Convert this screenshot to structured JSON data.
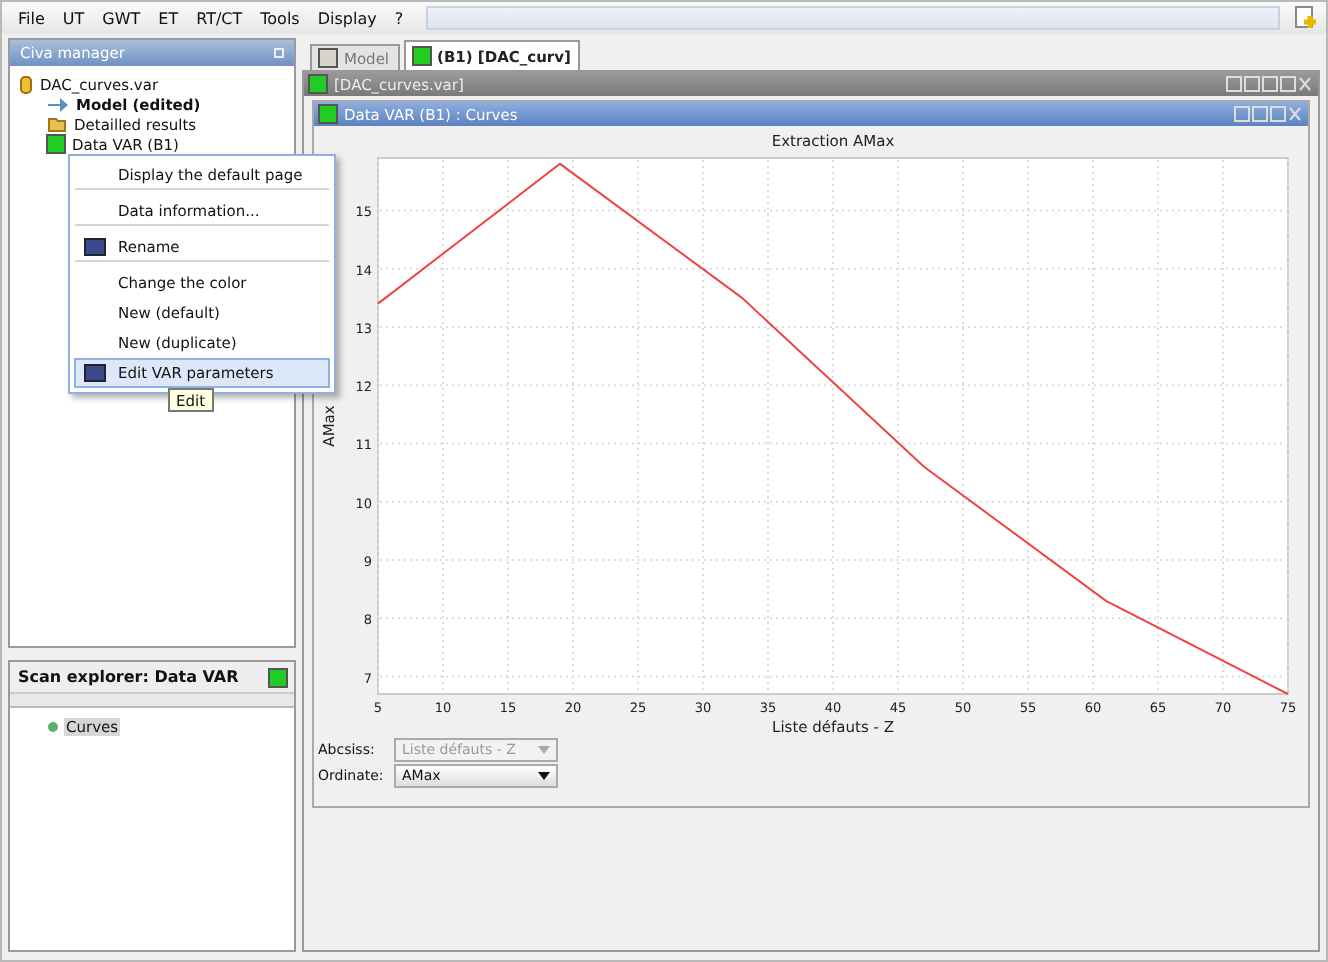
{
  "menu": [
    "File",
    "UT",
    "GWT",
    "ET",
    "RT/CT",
    "Tools",
    "Display",
    "?"
  ],
  "manager": {
    "title": "Civa manager",
    "tree": [
      {
        "label": "DAC_curves.var",
        "kind": "file",
        "bold": false,
        "children": [
          {
            "label": "Model (edited)",
            "kind": "model",
            "bold": true
          },
          {
            "label": "Detailled results",
            "kind": "folder",
            "bold": false
          },
          {
            "label": "Data VAR (B1)",
            "kind": "data",
            "bold": false
          }
        ]
      }
    ]
  },
  "context_menu": {
    "items": [
      {
        "label": "Display the default page",
        "icon": false,
        "selected": false,
        "separator_after": true
      },
      {
        "label": "Data information...",
        "icon": false,
        "selected": false,
        "separator_after": true
      },
      {
        "label": "Rename",
        "icon": true,
        "selected": false,
        "separator_after": true
      },
      {
        "label": "Change the color",
        "icon": false,
        "selected": false,
        "separator_after": false
      },
      {
        "label": "New (default)",
        "icon": false,
        "selected": false,
        "separator_after": false
      },
      {
        "label": "New (duplicate)",
        "icon": false,
        "selected": false,
        "separator_after": false
      },
      {
        "label": "Edit VAR parameters",
        "icon": true,
        "selected": true,
        "separator_after": false
      }
    ]
  },
  "tooltip": "Edit",
  "scan_explorer": {
    "title": "Scan explorer: Data VAR",
    "items": [
      {
        "label": "Curves",
        "selected": true
      }
    ]
  },
  "tabs": [
    {
      "label": "Model",
      "selected": false,
      "color": "#d8d4c8"
    },
    {
      "label": "(B1) [DAC_curv]",
      "selected": true,
      "color": "#22cc22"
    }
  ],
  "document_title": "[DAC_curves.var]",
  "subwindow_title": "Data VAR (B1) : Curves",
  "chart": {
    "chart_data": {
      "type": "line",
      "title": "Extraction AMax",
      "xlabel": "Liste défauts - Z",
      "ylabel": "AMax",
      "grid": true,
      "x": [
        5,
        19,
        33,
        47,
        61,
        75
      ],
      "series": [
        {
          "color": "#ee4444",
          "values": [
            13.4,
            15.8,
            13.5,
            10.6,
            8.3,
            6.7
          ]
        }
      ],
      "xlim": [
        5,
        75
      ],
      "ylim": [
        6.7,
        15.9
      ],
      "xticks": [
        5,
        10,
        15,
        20,
        25,
        30,
        35,
        40,
        45,
        50,
        55,
        60,
        65,
        70,
        75
      ],
      "yticks": [
        7,
        8,
        9,
        10,
        11,
        12,
        13,
        14,
        15
      ]
    }
  },
  "abscissa": {
    "label": "Abcsiss:",
    "value": "Liste défauts - Z",
    "disabled": true
  },
  "ordinate": {
    "label": "Ordinate:",
    "value": "AMax",
    "disabled": false
  }
}
